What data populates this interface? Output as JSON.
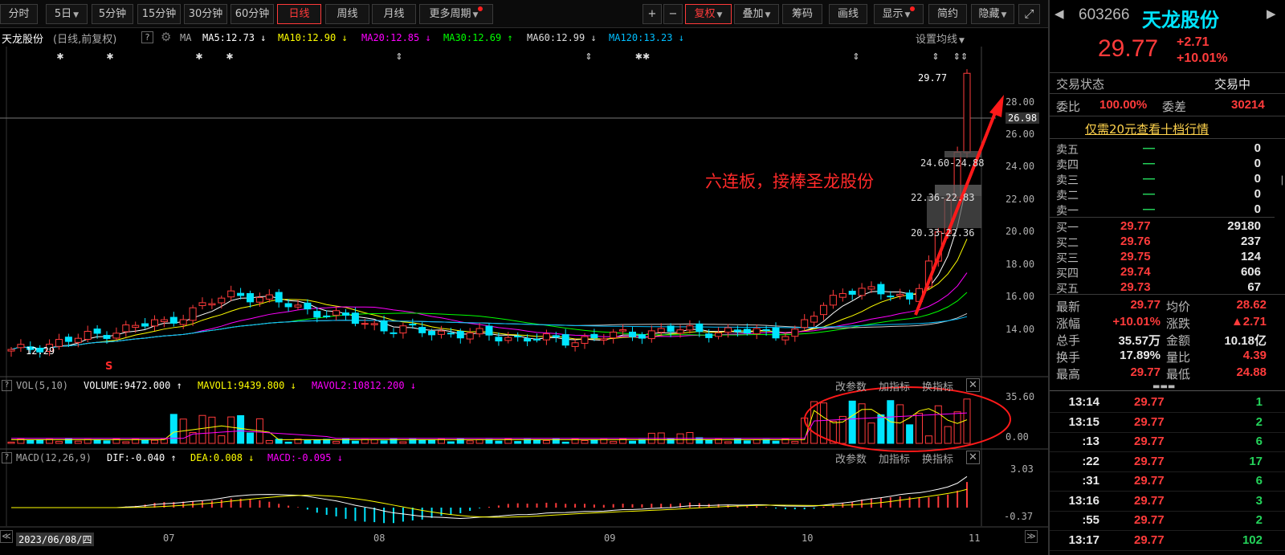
{
  "toolbar": {
    "periods": [
      "分时",
      "5日",
      "5分钟",
      "15分钟",
      "30分钟",
      "60分钟",
      "日线",
      "周线",
      "月线",
      "更多周期"
    ],
    "right_buttons": [
      "复权",
      "叠加",
      "筹码",
      "画线",
      "显示",
      "简约",
      "隐藏"
    ],
    "plus": "+",
    "minus": "−"
  },
  "header": {
    "name": "天龙股份",
    "mode": "(日线,前复权)",
    "help": "?",
    "ma_label": "MA",
    "ma5": "MA5:12.73",
    "ma10": "MA10:12.90",
    "ma20": "MA20:12.85",
    "ma30": "MA30:12.69",
    "ma60": "MA60:12.99",
    "ma120": "MA120:13.23",
    "arrow_down": "↓",
    "arrow_up": "↑",
    "settings": "设置均线"
  },
  "price_chart": {
    "y_labels": [
      "28.00",
      "26.98",
      "26.00",
      "24.00",
      "22.00",
      "20.00",
      "18.00",
      "16.00",
      "14.00"
    ],
    "high_label": "29.77",
    "low_label": "12.29",
    "zone1": "24.60-24.88",
    "zone2": "22.36-22.83",
    "zone3": "20.33-22.36",
    "annotation": "六连板，接棒圣龙股份",
    "signal_s": "S"
  },
  "volume": {
    "title": "VOL(5,10)",
    "volume": "VOLUME:9472.000",
    "mavol1": "MAVOL1:9439.800",
    "mavol2": "MAVOL2:10812.200",
    "links": [
      "改参数",
      "加指标",
      "换指标"
    ],
    "y_top": "35.60",
    "y_bottom": "0.00"
  },
  "macd": {
    "title": "MACD(12,26,9)",
    "dif": "DIF:-0.040",
    "dea": "DEA:0.008",
    "macd": "MACD:-0.095",
    "links": [
      "改参数",
      "加指标",
      "换指标"
    ],
    "y_top": "3.03",
    "y_bottom": "-0.37"
  },
  "x_axis": {
    "date": "2023/06/08/四",
    "months": [
      "07",
      "08",
      "09",
      "10",
      "11"
    ]
  },
  "quote": {
    "code": "603266",
    "name": "天龙股份",
    "price": "29.77",
    "change": "+2.71",
    "pct": "+10.01%",
    "status_label": "交易状态",
    "status": "交易中",
    "weibi_label": "委比",
    "weibi": "100.00%",
    "weicha_label": "委差",
    "weicha": "30214",
    "level10_link": "仅需20元查看十档行情",
    "asks": [
      {
        "label": "卖五",
        "price": "—",
        "vol": "0"
      },
      {
        "label": "卖四",
        "price": "—",
        "vol": "0"
      },
      {
        "label": "卖三",
        "price": "—",
        "vol": "0"
      },
      {
        "label": "卖二",
        "price": "—",
        "vol": "0"
      },
      {
        "label": "卖一",
        "price": "—",
        "vol": "0"
      }
    ],
    "bids": [
      {
        "label": "买一",
        "price": "29.77",
        "vol": "29180"
      },
      {
        "label": "买二",
        "price": "29.76",
        "vol": "237"
      },
      {
        "label": "买三",
        "price": "29.75",
        "vol": "124"
      },
      {
        "label": "买四",
        "price": "29.74",
        "vol": "606"
      },
      {
        "label": "买五",
        "price": "29.73",
        "vol": "67"
      }
    ],
    "stats": [
      {
        "l1": "最新",
        "v1": "29.77",
        "l2": "均价",
        "v2": "28.62",
        "c1": "red",
        "c2": "red"
      },
      {
        "l1": "涨幅",
        "v1": "+10.01%",
        "l2": "涨跌",
        "v2": "▲2.71",
        "c1": "red",
        "c2": "red"
      },
      {
        "l1": "总手",
        "v1": "35.57万",
        "l2": "金额",
        "v2": "10.18亿",
        "c1": "white",
        "c2": "white"
      },
      {
        "l1": "换手",
        "v1": "17.89%",
        "l2": "量比",
        "v2": "4.39",
        "c1": "white",
        "c2": "red"
      },
      {
        "l1": "最高",
        "v1": "29.77",
        "l2": "最低",
        "v2": "24.88",
        "c1": "red",
        "c2": "red"
      }
    ],
    "ticks": [
      {
        "time": "13:14",
        "price": "29.77",
        "vol": "1"
      },
      {
        "time": "13:15",
        "price": "29.77",
        "vol": "2"
      },
      {
        "time": ":13",
        "price": "29.77",
        "vol": "6"
      },
      {
        "time": ":22",
        "price": "29.77",
        "vol": "17"
      },
      {
        "time": ":31",
        "price": "29.77",
        "vol": "6"
      },
      {
        "time": "13:16",
        "price": "29.77",
        "vol": "3"
      },
      {
        "time": ":55",
        "price": "29.77",
        "vol": "2"
      },
      {
        "time": "13:17",
        "price": "29.77",
        "vol": "102"
      }
    ]
  },
  "colors": {
    "up": "#ff3b3b",
    "down": "#00e5ff",
    "ma5": "#ffffff",
    "ma10": "#ffff00",
    "ma20": "#ff00ff",
    "ma30": "#00ff00",
    "ma60": "#cccccc",
    "ma120": "#00bfff"
  }
}
